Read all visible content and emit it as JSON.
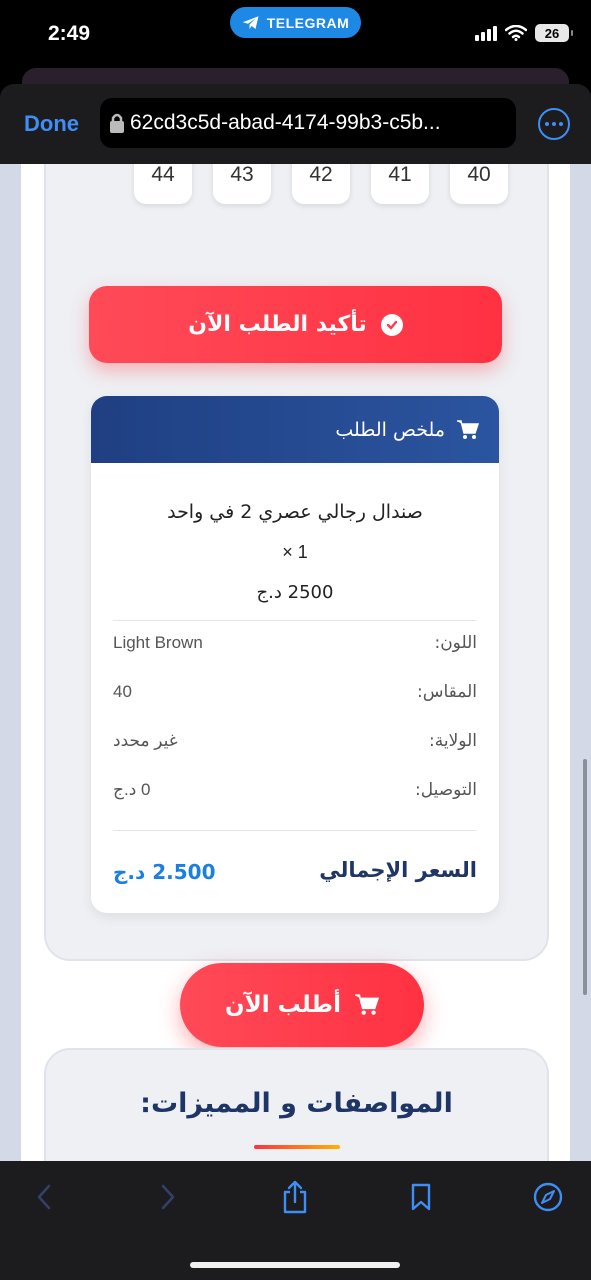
{
  "status_bar": {
    "time": "2:49",
    "app_pill": "TELEGRAM",
    "battery": "26"
  },
  "browser": {
    "done_label": "Done",
    "url": "62cd3c5d-abad-4174-99b3-c5b..."
  },
  "sizes": [
    "40",
    "41",
    "42",
    "43",
    "44"
  ],
  "confirm_button": "تأكيد الطلب الآن",
  "summary": {
    "header": "ملخص الطلب",
    "product_name": "صندال رجالي عصري 2 في واحد",
    "quantity": "× 1",
    "unit_price": "2500 د.ج",
    "rows": [
      {
        "label": "اللون:",
        "value": "Light Brown"
      },
      {
        "label": "المقاس:",
        "value": "40"
      },
      {
        "label": "الولاية:",
        "value": "غير محدد"
      },
      {
        "label": "التوصيل:",
        "value": "0 د.ج"
      }
    ],
    "total_label": "السعر الإجمالي",
    "total_value": "2.500 د.ج"
  },
  "order_button": "أطلب الآن",
  "specs_title": "المواصفات و المميزات:",
  "colors": {
    "accent_red": "#ff3142",
    "navy": "#1f3f82",
    "price_blue": "#1a7fe0",
    "ios_blue": "#3f8ef5"
  },
  "icons": [
    "telegram-icon",
    "lock-icon",
    "more-icon",
    "check-circle-icon",
    "cart-icon",
    "back-icon",
    "forward-icon",
    "share-icon",
    "bookmark-icon",
    "compass-icon"
  ]
}
